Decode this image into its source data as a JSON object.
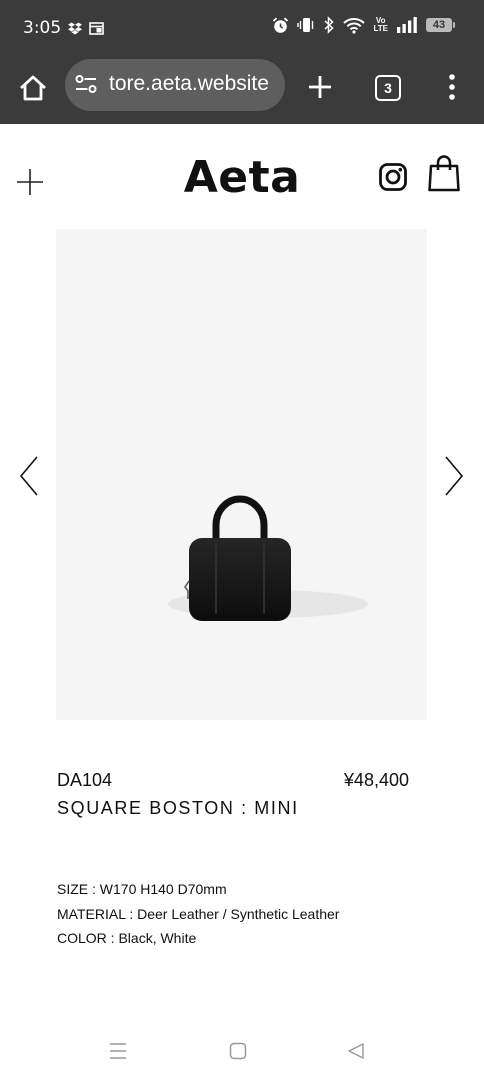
{
  "status_bar": {
    "time": "3:05",
    "battery": "43",
    "network": "Vo LTE"
  },
  "browser": {
    "url_visible": "tore.aeta.website",
    "tab_count": "3"
  },
  "site": {
    "logo": "Aeta"
  },
  "product": {
    "code": "DA104",
    "price": "¥48,400",
    "name": "SQUARE BOSTON : MINI",
    "specs": [
      "SIZE : W170 H140 D70mm",
      "MATERIAL : Deer Leather / Synthetic Leather",
      "COLOR : Black, White"
    ]
  },
  "icons": {
    "status_left": [
      "dropbox-icon",
      "cast-icon"
    ],
    "status_right": [
      "alarm-icon",
      "vibrate-icon",
      "bluetooth-icon",
      "wifi-icon",
      "lte-icon",
      "signal-icon",
      "battery-icon"
    ],
    "toolbar": [
      "home-icon",
      "tune-icon",
      "plus-icon",
      "tabs-icon",
      "more-icon"
    ],
    "header": [
      "plus-menu-icon",
      "instagram-icon",
      "shopping-bag-icon"
    ],
    "gallery": [
      "chevron-left-icon",
      "chevron-right-icon"
    ],
    "nav": [
      "recents-icon",
      "home-nav-icon",
      "back-icon"
    ]
  }
}
